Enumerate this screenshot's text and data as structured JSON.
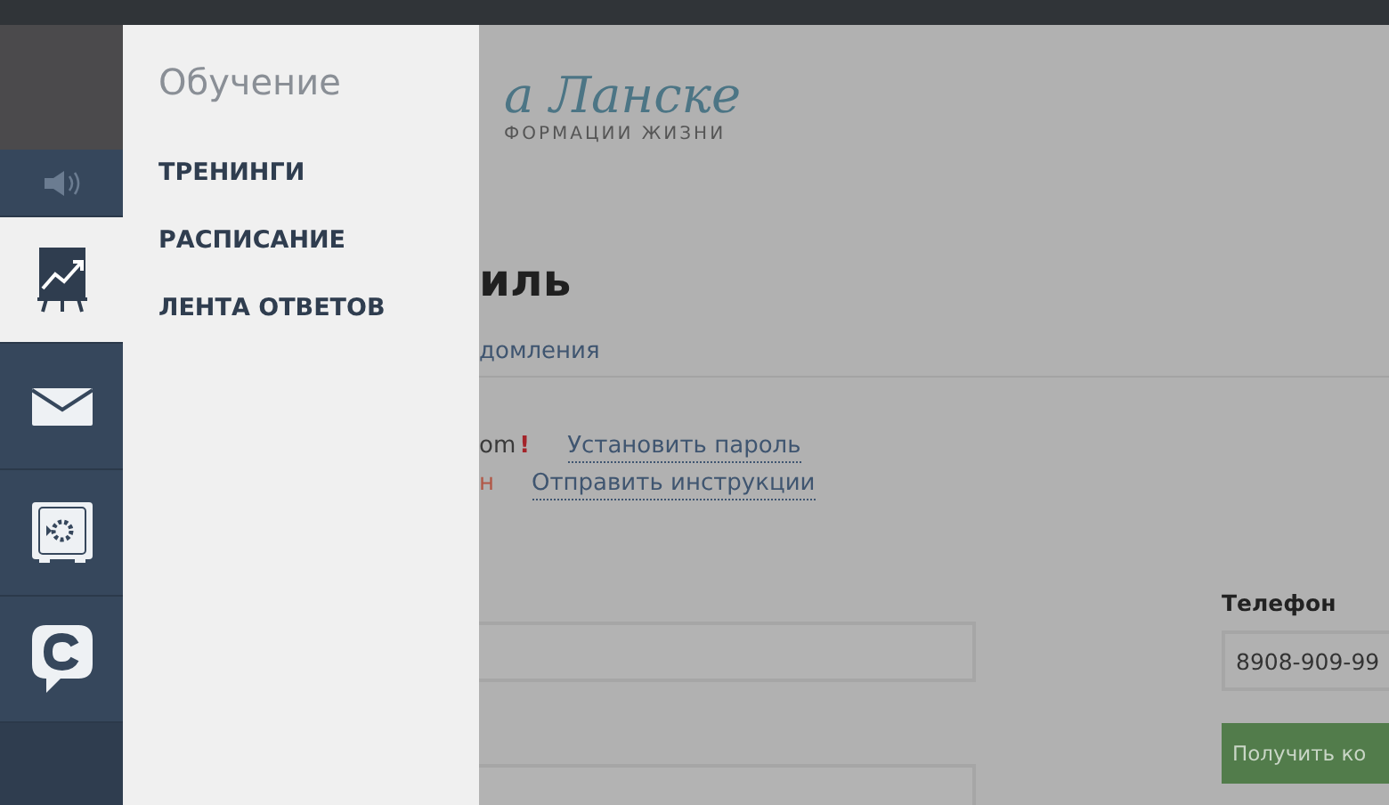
{
  "sidebar": {
    "items": [
      {
        "kind": "sound",
        "selected": false
      },
      {
        "kind": "chart",
        "selected": true
      },
      {
        "kind": "mail",
        "selected": false
      },
      {
        "kind": "safe",
        "selected": false
      },
      {
        "kind": "chat",
        "selected": false
      }
    ]
  },
  "drawer": {
    "title": "Обучение",
    "items": [
      {
        "label": "ТРЕНИНГИ"
      },
      {
        "label": "РАСПИСАНИЕ"
      },
      {
        "label": "ЛЕНТА ОТВЕТОВ"
      }
    ]
  },
  "page": {
    "logo": {
      "name": "а Ланске",
      "tagline": "ФОРМАЦИИ ЖИЗНИ"
    },
    "heading": "иль",
    "tab": "домления",
    "email": {
      "value": "om",
      "warning": "!",
      "link": "Установить пароль"
    },
    "status": {
      "value": "н",
      "link": "Отправить инструкции"
    },
    "phone": {
      "label": "Телефон",
      "value": "8908-909-99",
      "button": "Получить ко"
    }
  }
}
